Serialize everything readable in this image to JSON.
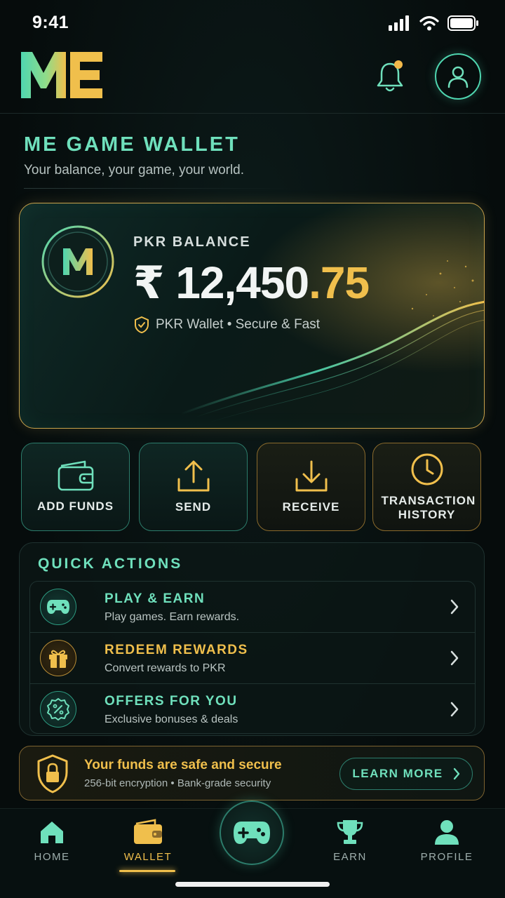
{
  "status_bar": {
    "time": "9:41"
  },
  "header": {
    "logo_text": "ME"
  },
  "page": {
    "title": "ME GAME WALLET",
    "subtitle": "Your balance, your game, your world."
  },
  "balance": {
    "label": "PKR BALANCE",
    "currency_symbol": "₹",
    "amount_whole": "12,450",
    "amount_decimal": ".75",
    "wallet_info": "PKR Wallet • Secure & Fast"
  },
  "actions": [
    {
      "label": "ADD FUNDS",
      "icon": "wallet-icon"
    },
    {
      "label": "SEND",
      "icon": "upload-icon"
    },
    {
      "label": "RECEIVE",
      "icon": "download-icon"
    },
    {
      "label": "TRANSACTION HISTORY",
      "icon": "clock-icon"
    }
  ],
  "quick_actions": {
    "title": "QUICK ACTIONS",
    "items": [
      {
        "name": "PLAY & EARN",
        "desc": "Play games. Earn rewards.",
        "icon": "gamepad-icon",
        "color": "#6fe0bc"
      },
      {
        "name": "REDEEM REWARDS",
        "desc": "Convert rewards to PKR",
        "icon": "gift-icon",
        "color": "#f0bf4c"
      },
      {
        "name": "OFFERS FOR YOU",
        "desc": "Exclusive bonuses & deals",
        "icon": "percent-badge-icon",
        "color": "#6fe0bc"
      }
    ]
  },
  "security": {
    "title": "Your funds are safe and secure",
    "desc": "256-bit encryption • Bank-grade security",
    "button": "LEARN MORE"
  },
  "nav": {
    "items": [
      {
        "label": "HOME",
        "icon": "home-icon"
      },
      {
        "label": "WALLET",
        "icon": "wallet-icon",
        "active": true
      },
      {
        "label": "",
        "icon": "gamepad-icon"
      },
      {
        "label": "EARN",
        "icon": "trophy-icon"
      },
      {
        "label": "PROFILE",
        "icon": "person-icon"
      }
    ]
  },
  "colors": {
    "accent_teal": "#6fe0bc",
    "accent_gold": "#f0bf4c",
    "background": "#07100f"
  }
}
